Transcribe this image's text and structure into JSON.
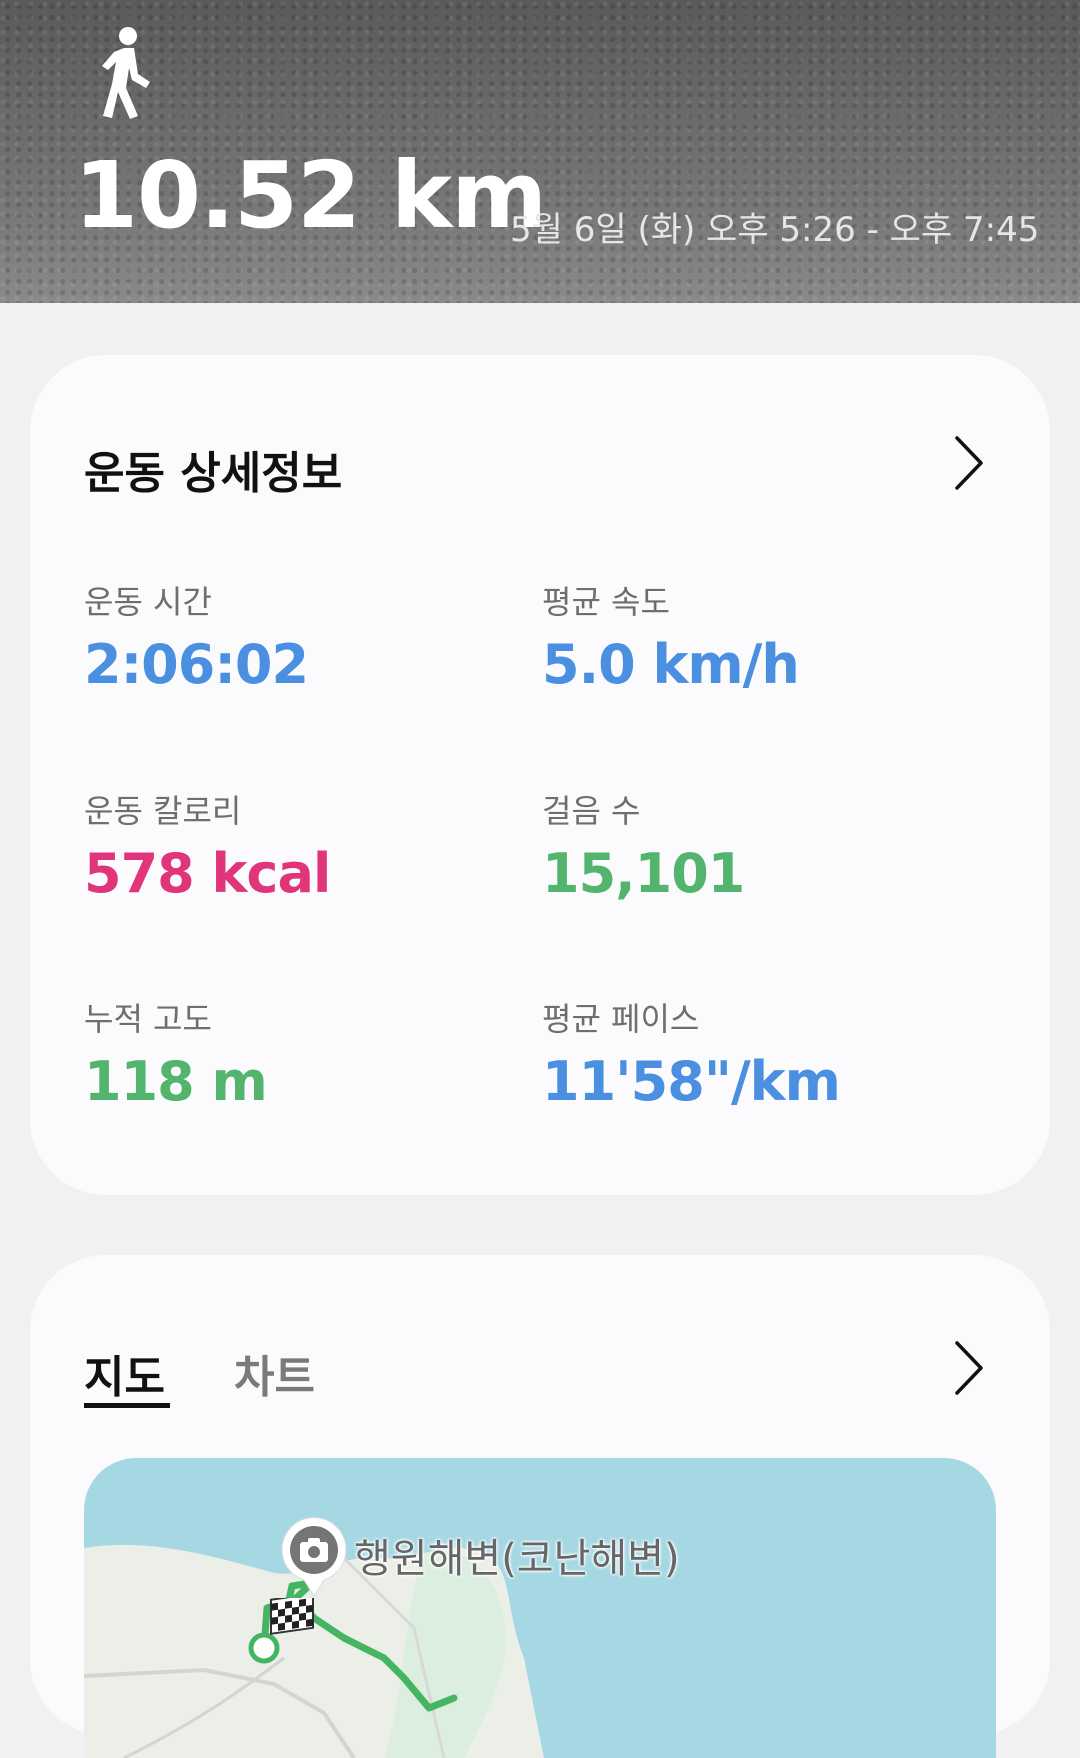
{
  "header": {
    "activity_icon": "walking-person-icon",
    "distance": "10.52 km",
    "datetime": "5월 6일 (화) 오후 5:26 - 오후 7:45"
  },
  "details_card": {
    "title": "운동 상세정보",
    "chevron_icon": "chevron-right-icon",
    "stats": [
      {
        "label": "운동 시간",
        "value": "2:06:02",
        "color": "#4a8fe0"
      },
      {
        "label": "평균 속도",
        "value": "5.0 km/h",
        "color": "#4a8fe0"
      },
      {
        "label": "운동 칼로리",
        "value": "578 kcal",
        "color": "#e0357a"
      },
      {
        "label": "걸음 수",
        "value": "15,101",
        "color": "#53b46e"
      },
      {
        "label": "누적 고도",
        "value": "118 m",
        "color": "#53b46e"
      },
      {
        "label": "평균 페이스",
        "value": "11'58\"/km",
        "color": "#4a8fe0"
      }
    ]
  },
  "map_card": {
    "tabs": [
      {
        "label": "지도",
        "selected": true
      },
      {
        "label": "차트",
        "selected": false
      }
    ],
    "chevron_icon": "chevron-right-icon",
    "map": {
      "place_label": "행원해변(코난해변)",
      "pin_icon": "camera-pin-icon",
      "finish_icon": "checkered-flag-icon"
    }
  }
}
